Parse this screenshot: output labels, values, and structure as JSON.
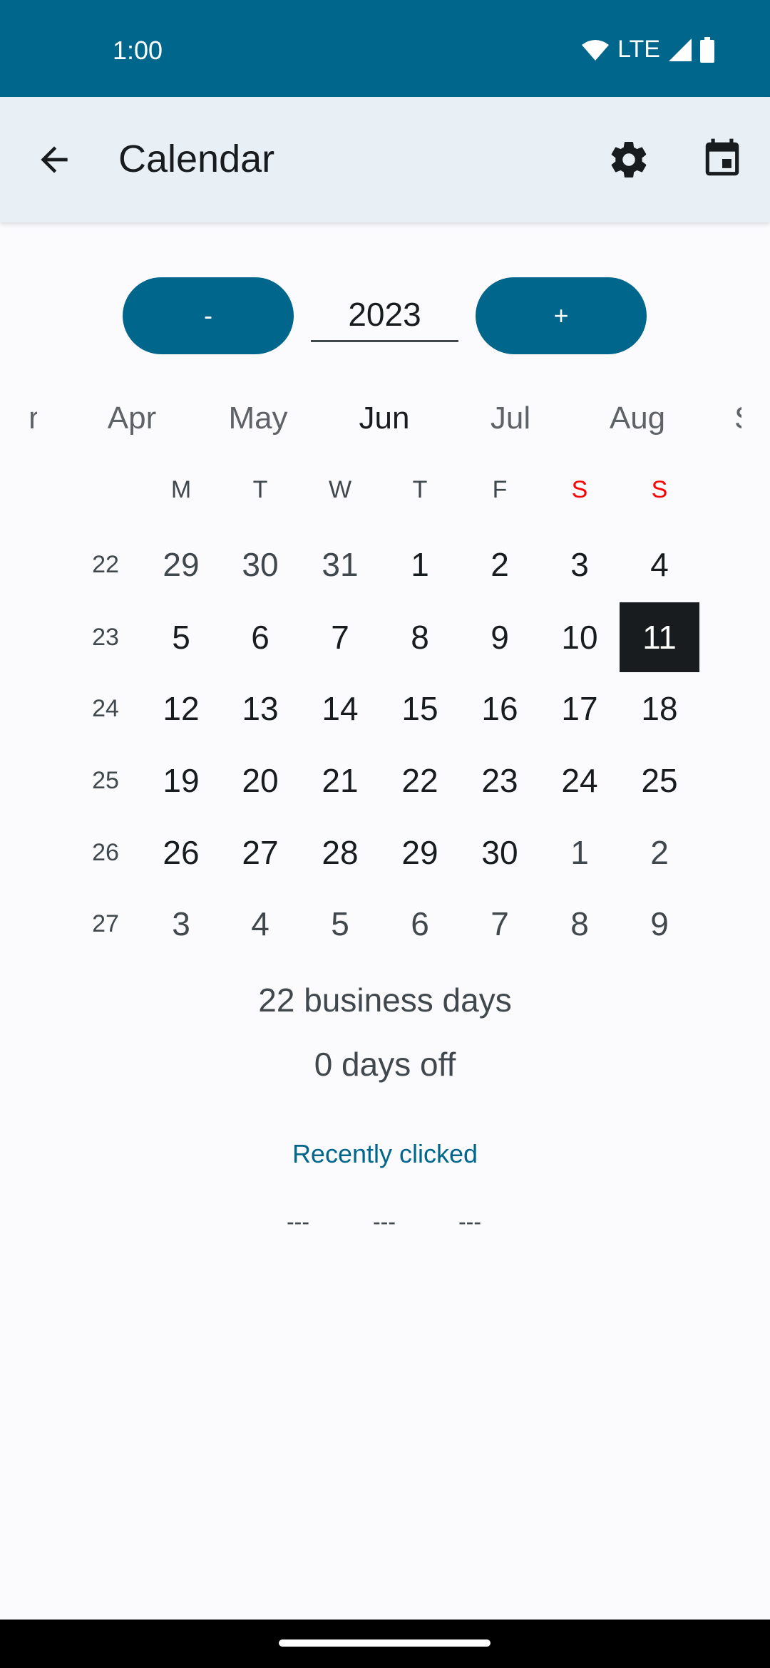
{
  "status_bar": {
    "time": "1:00",
    "network": "LTE"
  },
  "app_bar": {
    "title": "Calendar"
  },
  "year_control": {
    "minus_label": "-",
    "plus_label": "+",
    "year": "2023"
  },
  "months": [
    "r",
    "Apr",
    "May",
    "Jun",
    "Jul",
    "Aug",
    "S"
  ],
  "current_month": "Jun",
  "weekdays": [
    "M",
    "T",
    "W",
    "T",
    "F",
    "S",
    "S"
  ],
  "weeks": [
    {
      "week": "22",
      "days": [
        "29",
        "30",
        "31",
        "1",
        "2",
        "3",
        "4"
      ],
      "other": [
        1,
        1,
        1,
        0,
        0,
        0,
        0
      ]
    },
    {
      "week": "23",
      "days": [
        "5",
        "6",
        "7",
        "8",
        "9",
        "10",
        "11"
      ],
      "other": [
        0,
        0,
        0,
        0,
        0,
        0,
        0
      ]
    },
    {
      "week": "24",
      "days": [
        "12",
        "13",
        "14",
        "15",
        "16",
        "17",
        "18"
      ],
      "other": [
        0,
        0,
        0,
        0,
        0,
        0,
        0
      ]
    },
    {
      "week": "25",
      "days": [
        "19",
        "20",
        "21",
        "22",
        "23",
        "24",
        "25"
      ],
      "other": [
        0,
        0,
        0,
        0,
        0,
        0,
        0
      ]
    },
    {
      "week": "26",
      "days": [
        "26",
        "27",
        "28",
        "29",
        "30",
        "1",
        "2"
      ],
      "other": [
        0,
        0,
        0,
        0,
        0,
        1,
        1
      ]
    },
    {
      "week": "27",
      "days": [
        "3",
        "4",
        "5",
        "6",
        "7",
        "8",
        "9"
      ],
      "other": [
        1,
        1,
        1,
        1,
        1,
        1,
        1
      ]
    }
  ],
  "selected_day": "11",
  "summary": {
    "business_days": "22 business days",
    "days_off": "0 days off"
  },
  "recent": {
    "label": "Recently clicked",
    "items": [
      "---",
      "---",
      "---"
    ]
  },
  "colors": {
    "primary": "#00668b",
    "weekend": "#ff0000",
    "appbar": "#e8eff5"
  }
}
